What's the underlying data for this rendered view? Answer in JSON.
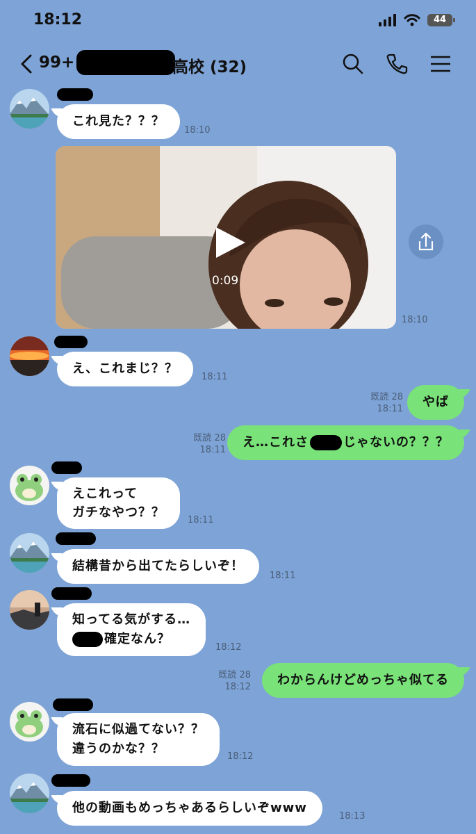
{
  "status": {
    "time": "18:12",
    "battery": "44"
  },
  "header": {
    "unread_count": "99+",
    "title": "高校 (32)"
  },
  "messages": [
    {
      "text": "これ見た？？？",
      "time": "18:10"
    },
    {
      "video_duration": "0:09",
      "time": "18:10"
    },
    {
      "text": "え、これまじ？？",
      "time": "18:11"
    },
    {
      "text": "やば",
      "read": "既読 28",
      "time": "18:11"
    },
    {
      "text_before": "え…これさ",
      "text_after": "じゃないの？？？",
      "read": "既読 28",
      "time": "18:11"
    },
    {
      "lines": [
        "えこれって",
        "ガチなやつ？？"
      ],
      "time": "18:11"
    },
    {
      "text": "結構昔から出てたらしいぞ！",
      "time": "18:11"
    },
    {
      "line1": "知ってる気がする…",
      "line2": "確定なん？",
      "time": "18:12"
    },
    {
      "text": "わからんけどめっちゃ似てる",
      "read": "既読 28",
      "time": "18:12"
    },
    {
      "lines": [
        "流石に似過てない？？",
        "違うのかな？？"
      ],
      "time": "18:12"
    },
    {
      "text": "他の動画もめっちゃあるらしいぞwww",
      "time": "18:13"
    }
  ],
  "icons": [
    "back-chevron",
    "search",
    "phone",
    "menu",
    "play",
    "share"
  ]
}
